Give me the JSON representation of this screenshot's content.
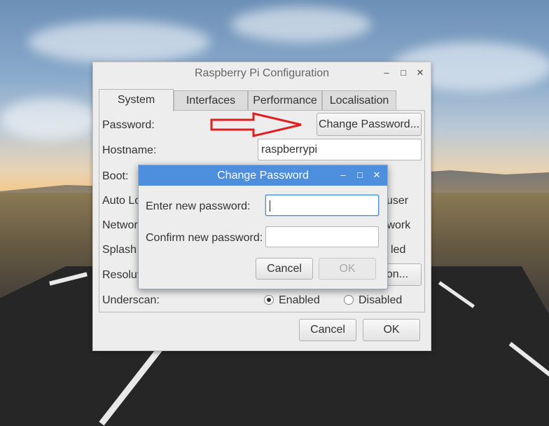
{
  "window": {
    "title": "Raspberry Pi Configuration",
    "tabs": [
      "System",
      "Interfaces",
      "Performance",
      "Localisation"
    ],
    "active_tab": "System",
    "rows": {
      "password_label": "Password:",
      "change_password_button": "Change Password...",
      "hostname_label": "Hostname:",
      "hostname_value": "raspberrypi",
      "boot_label": "Boot:",
      "autologin_label": "Auto Lo",
      "autologin_right": "user",
      "network_label": "Networ",
      "network_right": "twork",
      "splash_label": "Splash",
      "splash_right": "led",
      "resolution_label": "Resolut",
      "resolution_button": "on...",
      "underscan_label": "Underscan:",
      "underscan_enabled": "Enabled",
      "underscan_disabled": "Disabled",
      "underscan_selected": "Enabled"
    },
    "cancel_label": "Cancel",
    "ok_label": "OK"
  },
  "dialog": {
    "title": "Change Password",
    "new_password_label": "Enter new password:",
    "confirm_password_label": "Confirm new password:",
    "new_password_value": "",
    "confirm_password_value": "",
    "cancel_label": "Cancel",
    "ok_label": "OK"
  },
  "annotation": {
    "arrow_color": "#e02020"
  },
  "colors": {
    "dialog_titlebar": "#4d8fdc",
    "window_bg": "#ededed"
  }
}
